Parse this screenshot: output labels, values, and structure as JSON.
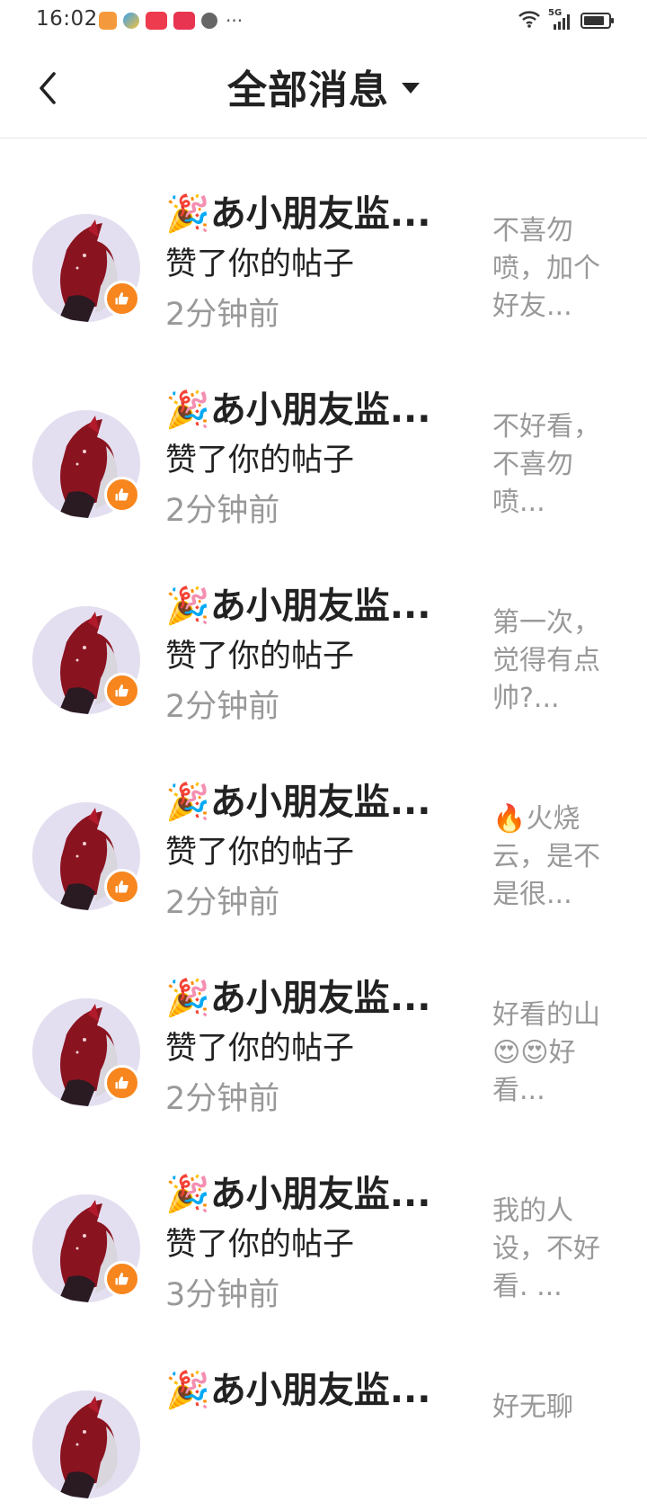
{
  "status_bar": {
    "time": "16:02",
    "dots": "···",
    "network_label": "5G",
    "icons": [
      "notification-app-icon",
      "notification-app-icon",
      "notification-app-icon",
      "notification-app-icon",
      "notification-app-icon",
      "wifi-icon",
      "cellular-signal-icon",
      "battery-icon"
    ]
  },
  "header": {
    "title": "全部消息",
    "back_icon": "chevron-left-icon",
    "dropdown_icon": "caret-down-icon"
  },
  "colors": {
    "badge": "#f7861e",
    "secondary_text": "#999999",
    "primary_text": "#222222",
    "divider": "#e5e5e5"
  },
  "messages": [
    {
      "emoji": "🎉",
      "name": "あ小朋友监...",
      "action": "赞了你的帖子",
      "time": "2分钟前",
      "preview": "不喜勿喷，加个好友..."
    },
    {
      "emoji": "🎉",
      "name": "あ小朋友监...",
      "action": "赞了你的帖子",
      "time": "2分钟前",
      "preview": "不好看，不喜勿喷..."
    },
    {
      "emoji": "🎉",
      "name": "あ小朋友监...",
      "action": "赞了你的帖子",
      "time": "2分钟前",
      "preview": "第一次，觉得有点帅?..."
    },
    {
      "emoji": "🎉",
      "name": "あ小朋友监...",
      "action": "赞了你的帖子",
      "time": "2分钟前",
      "preview": "🔥火烧云，是不是很..."
    },
    {
      "emoji": "🎉",
      "name": "あ小朋友监...",
      "action": "赞了你的帖子",
      "time": "2分钟前",
      "preview": "好看的山😍😍好看..."
    },
    {
      "emoji": "🎉",
      "name": "あ小朋友监...",
      "action": "赞了你的帖子",
      "time": "3分钟前",
      "preview": "我的人设，不好看. ..."
    },
    {
      "emoji": "🎉",
      "name": "あ小朋友监...",
      "action": "",
      "time": "",
      "preview": "好无聊"
    }
  ]
}
